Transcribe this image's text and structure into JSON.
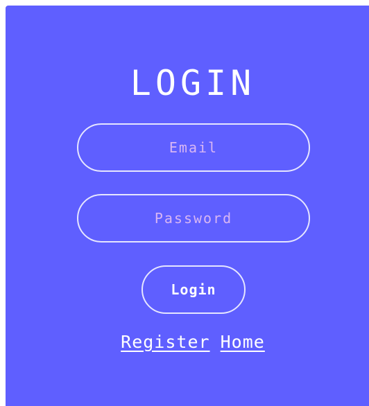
{
  "form": {
    "title": "LOGIN",
    "email_placeholder": "Email",
    "password_placeholder": "Password",
    "login_button_label": "Login"
  },
  "links": {
    "register_label": "Register",
    "home_label": "Home"
  },
  "colors": {
    "card_background": "#5f5fff",
    "field_border": "#e6e6ff",
    "placeholder_text": "#d8b6f4",
    "text": "#ffffff"
  }
}
